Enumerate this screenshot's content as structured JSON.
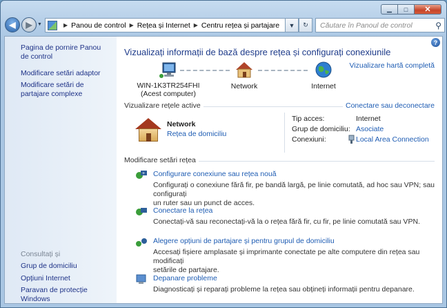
{
  "window": {
    "minimize": "▁",
    "maximize": "□",
    "close": "✕"
  },
  "address": {
    "crumbs": [
      "Panou de control",
      "Rețea și Internet",
      "Centru rețea și partajare"
    ],
    "search_placeholder": "Căutare în Panoul de control",
    "refresh_icon": "refresh-icon",
    "dropdown_icon": "chevron-down-icon"
  },
  "sidebar": {
    "items": [
      "Pagina de pornire Panou de control",
      "Modificare setări adaptor",
      "Modificare setări de partajare complexe"
    ],
    "see_also": "Consultați și",
    "see_also_items": [
      "Grup de domiciliu",
      "Opțiuni Internet",
      "Paravan de protecție Windows"
    ]
  },
  "main": {
    "title": "Vizualizați informații de bază despre rețea și configurați conexiunile",
    "full_map_link": "Vizualizare hartă completă",
    "computer_name": "WIN-1K3TR254FHI",
    "computer_sub": "(Acest computer)",
    "network_node": "Network",
    "internet_node": "Internet",
    "active_title": "Vizualizare rețele active",
    "connect_link": "Conectare sau deconectare",
    "network_name": "Network",
    "network_type": "Rețea de domiciliu",
    "access_label": "Tip acces:",
    "access_value": "Internet",
    "homegroup_label": "Grup de domiciliu:",
    "homegroup_value": "Asociate",
    "connections_label": "Conexiuni:",
    "connections_value": "Local Area Connection",
    "change_title": "Modificare setări rețea",
    "tasks": [
      {
        "title": "Configurare conexiune sau rețea nouă",
        "desc1": "Configurați o conexiune fără fir, pe bandă largă, pe linie comutată, ad hoc sau VPN; sau configurați",
        "desc2": "un ruter sau un punct de acces."
      },
      {
        "title": "Conectare la rețea",
        "desc1": "Conectați-vă sau reconectați-vă la o rețea fără fir, cu fir, pe linie comutată sau VPN.",
        "desc2": ""
      },
      {
        "title": "Alegere opțiuni de partajare și pentru grupul de domiciliu",
        "desc1": "Accesați fișiere amplasate și imprimante conectate pe alte computere din rețea sau modificați",
        "desc2": "setările de partajare."
      },
      {
        "title": "Depanare probleme",
        "desc1": "Diagnosticați și reparați probleme la rețea sau obțineți informații pentru depanare.",
        "desc2": ""
      }
    ]
  }
}
